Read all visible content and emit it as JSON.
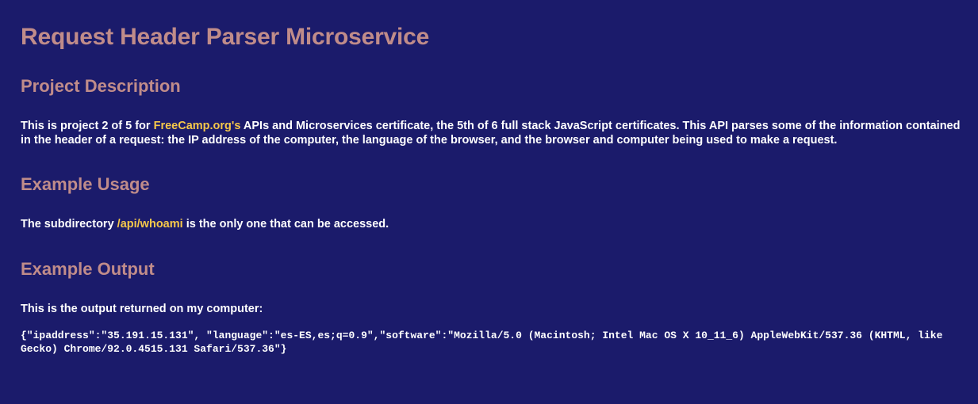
{
  "title": "Request Header Parser Microservice",
  "project_description": {
    "heading": "Project Description",
    "text_before_link": "This is project 2 of 5 for ",
    "link_text": "FreeCamp.org's",
    "text_after_link": " APIs and Microservices certificate, the 5th of 6 full stack JavaScript certificates. This API parses some of the information contained in the header of a request: the IP address of the computer, the language of the browser, and the browser and computer being used to make a request."
  },
  "example_usage": {
    "heading": "Example Usage",
    "text_before_link": "The subdirectory ",
    "link_text": "/api/whoami",
    "text_after_link": " is the only one that can be accessed."
  },
  "example_output": {
    "heading": "Example Output",
    "intro": "This is the output returned on my computer:",
    "code": "{\"ipaddress\":\"35.191.15.131\", \"language\":\"es-ES,es;q=0.9\",\"software\":\"Mozilla/5.0 (Macintosh; Intel Mac OS X 10_11_6) AppleWebKit/537.36 (KHTML, like Gecko) Chrome/92.0.4515.131 Safari/537.36\"}"
  },
  "colors": {
    "background": "#1b1b6b",
    "heading": "#c08c8a",
    "link": "#f6c84a",
    "text": "#ffffff"
  }
}
